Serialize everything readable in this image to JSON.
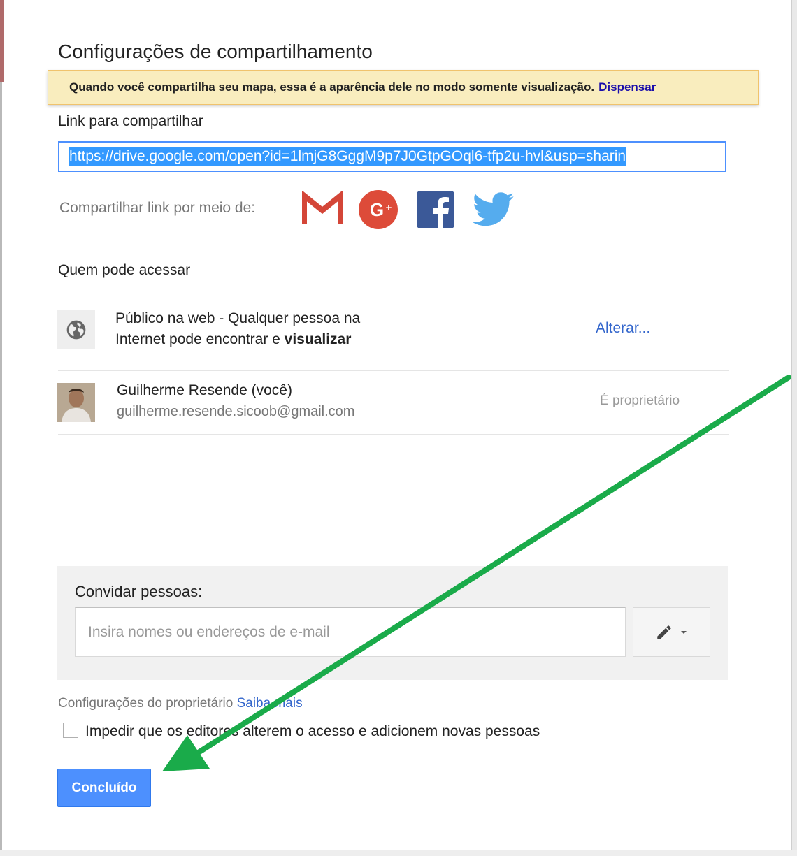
{
  "dialog": {
    "title": "Configurações de compartilhamento",
    "notice_text": "Quando você compartilha seu mapa, essa é a aparência dele no modo somente visualização.",
    "notice_dismiss": "Dispensar",
    "link_label": "Link para compartilhar",
    "link_value": "https://drive.google.com/open?id=1lmjG8GggM9p7J0GtpGOql6-tfp2u-hvl&usp=sharin",
    "share_via_label": "Compartilhar link por meio de:",
    "share_icons": [
      "gmail-icon",
      "google-plus-icon",
      "facebook-icon",
      "twitter-icon"
    ]
  },
  "access": {
    "label": "Quem pode acessar",
    "public_line1": "Público na web - Qualquer pessoa na",
    "public_line2_prefix": "Internet pode encontrar e ",
    "public_line2_bold": "visualizar",
    "change_link": "Alterar...",
    "owner_name": "Guilherme Resende (você)",
    "owner_email": "guilherme.resende.sicoob@gmail.com",
    "owner_role": "É proprietário"
  },
  "invite": {
    "label": "Convidar pessoas:",
    "placeholder": "Insira nomes ou endereços de e-mail"
  },
  "owner_settings": {
    "label": "Configurações do proprietário",
    "learn_more": "Saiba mais",
    "checkbox_label": "Impedir que os editores alterem o acesso e adicionem novas pessoas",
    "checkbox_checked": false
  },
  "done_button": "Concluído",
  "colors": {
    "accent_blue": "#4d90fe",
    "notice_bg": "#f9edbe",
    "annotation_arrow": "#1aab4a",
    "gmail_red": "#d44638",
    "gplus_red": "#dd4b39",
    "facebook_blue": "#3b5998",
    "twitter_blue": "#55acee"
  }
}
